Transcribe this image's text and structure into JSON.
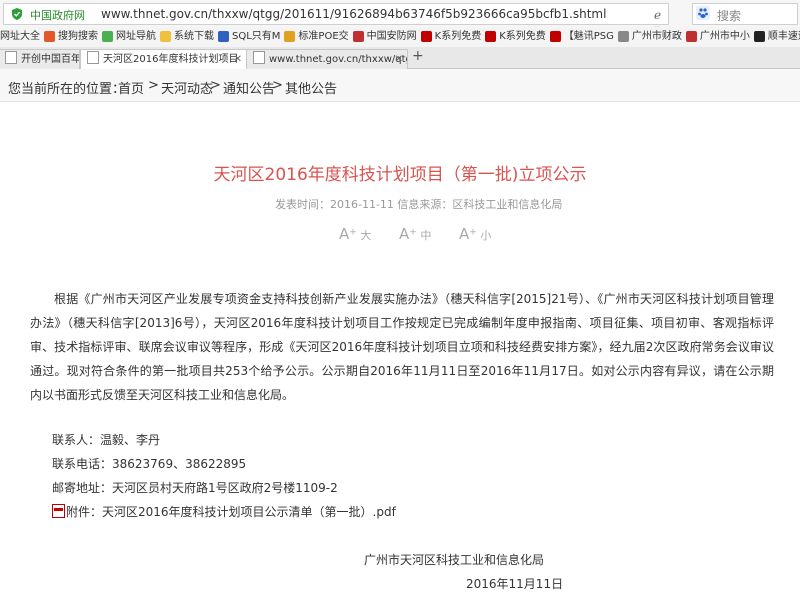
{
  "browser": {
    "site_label": "中国政府网",
    "url": "www.thnet.gov.cn/thxxw/qtgg/201611/91626894b63746f5b923666ca95bcfb1.shtml",
    "search_placeholder": "搜索",
    "bookmarks": [
      {
        "label": "网址大全",
        "color": "#3a8ee6"
      },
      {
        "label": "搜狗搜索",
        "color": "#e2582b"
      },
      {
        "label": "网址导航",
        "color": "#4caf50"
      },
      {
        "label": "系统下载",
        "color": "#f0c040"
      },
      {
        "label": "SQL只有M",
        "color": "#3060c0"
      },
      {
        "label": "标准POE交",
        "color": "#e0a020"
      },
      {
        "label": "中国安防网",
        "color": "#c03030"
      },
      {
        "label": "K系列免费",
        "color": "#c00000"
      },
      {
        "label": "K系列免费",
        "color": "#c00000"
      },
      {
        "label": "【魅讯PSG",
        "color": "#c00000"
      },
      {
        "label": "广州市财政",
        "color": "#888888"
      },
      {
        "label": "广州市中小",
        "color": "#c03030"
      },
      {
        "label": "顺丰速运",
        "color": "#222222"
      }
    ],
    "tabs": [
      {
        "label": "开创中国百年",
        "active": false
      },
      {
        "label": "天河区2016年度科技计划项目",
        "active": true
      },
      {
        "label": "www.thnet.gov.cn/thxxw/qtg",
        "active": false
      }
    ],
    "new_tab": "+"
  },
  "breadcrumb": {
    "prefix": "您当前所在的位置：",
    "items": [
      "首页",
      "天河动态",
      "通知公告",
      "其他公告"
    ],
    "sep": ">"
  },
  "article": {
    "title": "天河区2016年度科技计划项目（第一批)立项公示",
    "meta": "发表时间：2016-11-11    信息来源：区科技工业和信息化局",
    "font_sizes": [
      "大",
      "中",
      "小"
    ],
    "body": "根据《广州市天河区产业发展专项资金支持科技创新产业发展实施办法》（穗天科信字[2015]21号）、《广州市天河区科技计划项目管理办法》（穗天科信字[2013]6号），天河区2016年度科技计划项目工作按规定已完成编制年度申报指南、项目征集、项目初审、客观指标评审、技术指标评审、联席会议审议等程序，形成《天河区2016年度科技计划项目立项和科技经费安排方案》，经九届2次区政府常务会议审议通过。现对符合条件的第一批项目共253个给予公示。公示期自2016年11月11日至2016年11月17日。如对公示内容有异议，请在公示期内以书面形式反馈至天河区科技工业和信息化局。",
    "contact": "联系人：温毅、李丹",
    "phone": "联系电话：38623769、38622895",
    "address": "邮寄地址：天河区员村天府路1号区政府2号楼1109-2",
    "attachment": "附件：天河区2016年度科技计划项目公示清单（第一批）.pdf",
    "signature": "广州市天河区科技工业和信息化局",
    "date": "2016年11月11日"
  }
}
